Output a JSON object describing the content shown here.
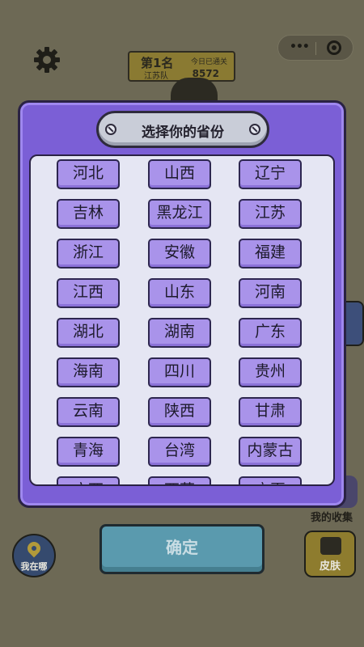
{
  "header": {
    "rank_title": "第1名",
    "rank_team": "江苏队",
    "today_label": "今日已通关",
    "today_score": "8572"
  },
  "icons": {
    "settings": "gear-icon",
    "more": "more-dots-icon",
    "close": "target-circle-icon",
    "locate": "location-pin-icon"
  },
  "modal": {
    "title": "选择你的省份",
    "provinces": [
      "河北",
      "山西",
      "辽宁",
      "吉林",
      "黑龙江",
      "江苏",
      "浙江",
      "安徽",
      "福建",
      "江西",
      "山东",
      "河南",
      "湖北",
      "湖南",
      "广东",
      "海南",
      "四川",
      "贵州",
      "云南",
      "陕西",
      "甘肃",
      "青海",
      "台湾",
      "内蒙古",
      "广西",
      "西藏",
      "宁夏"
    ]
  },
  "bottom": {
    "locate_label": "我在哪",
    "confirm_label": "确定",
    "collect_label": "我的收集",
    "skin_label": "皮肤"
  },
  "colors": {
    "modal_bg": "#7b5fd6",
    "button_bg": "#a993ea",
    "confirm_bg": "#5a9aae"
  }
}
